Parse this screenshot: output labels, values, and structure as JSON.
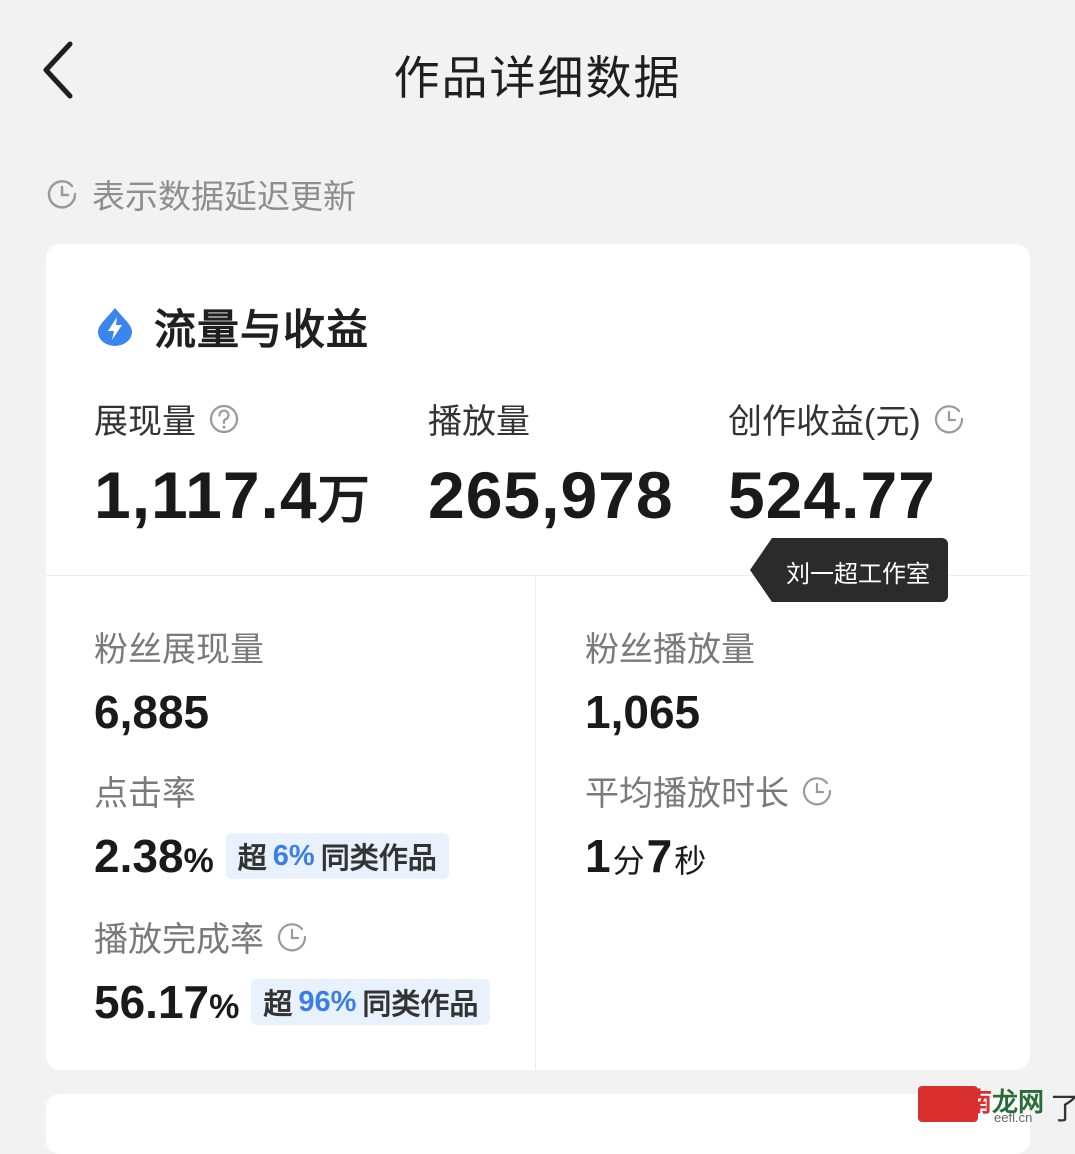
{
  "header": {
    "title": "作品详细数据",
    "back_icon": "chevron-left-icon"
  },
  "notice": {
    "text": "表示数据延迟更新",
    "icon": "clock-icon"
  },
  "section": {
    "title": "流量与收益",
    "icon": "water-drop-bolt-icon",
    "icon_color": "#3a86ee"
  },
  "top_metrics": [
    {
      "label": "展现量",
      "value": "1,117.4",
      "unit": "万",
      "icon": "help-circle-icon"
    },
    {
      "label": "播放量",
      "value": "265,978"
    },
    {
      "label": "创作收益(元)",
      "value": "524.77",
      "icon": "clock-icon"
    }
  ],
  "tooltip": {
    "text": "刘一超工作室"
  },
  "details": {
    "fan_impressions": {
      "label": "粉丝展现量",
      "value": "6,885"
    },
    "fan_plays": {
      "label": "粉丝播放量",
      "value": "1,065"
    },
    "ctr": {
      "label": "点击率",
      "value": "2.38",
      "suffix": "%",
      "badge_prefix": "超",
      "badge_value": "6%",
      "badge_suffix": "同类作品"
    },
    "avg_duration": {
      "label": "平均播放时长",
      "icon": "clock-icon",
      "min_num": "1",
      "min_unit": "分",
      "sec_num": "7",
      "sec_unit": "秒"
    },
    "completion": {
      "label": "播放完成率",
      "icon": "clock-icon",
      "value": "56.17",
      "suffix": "%",
      "badge_prefix": "超",
      "badge_value": "96%",
      "badge_suffix": "同类作品"
    }
  },
  "watermark": {
    "brand_a": "云南",
    "brand_b": "龙网",
    "domain": "eefl.cn",
    "glyph": "了"
  },
  "colors": {
    "background": "#f2f2f2",
    "card": "#ffffff",
    "accent_blue": "#3a7ee8",
    "badge_bg": "#e9f1fd",
    "tooltip_bg": "#2b2b2b"
  }
}
